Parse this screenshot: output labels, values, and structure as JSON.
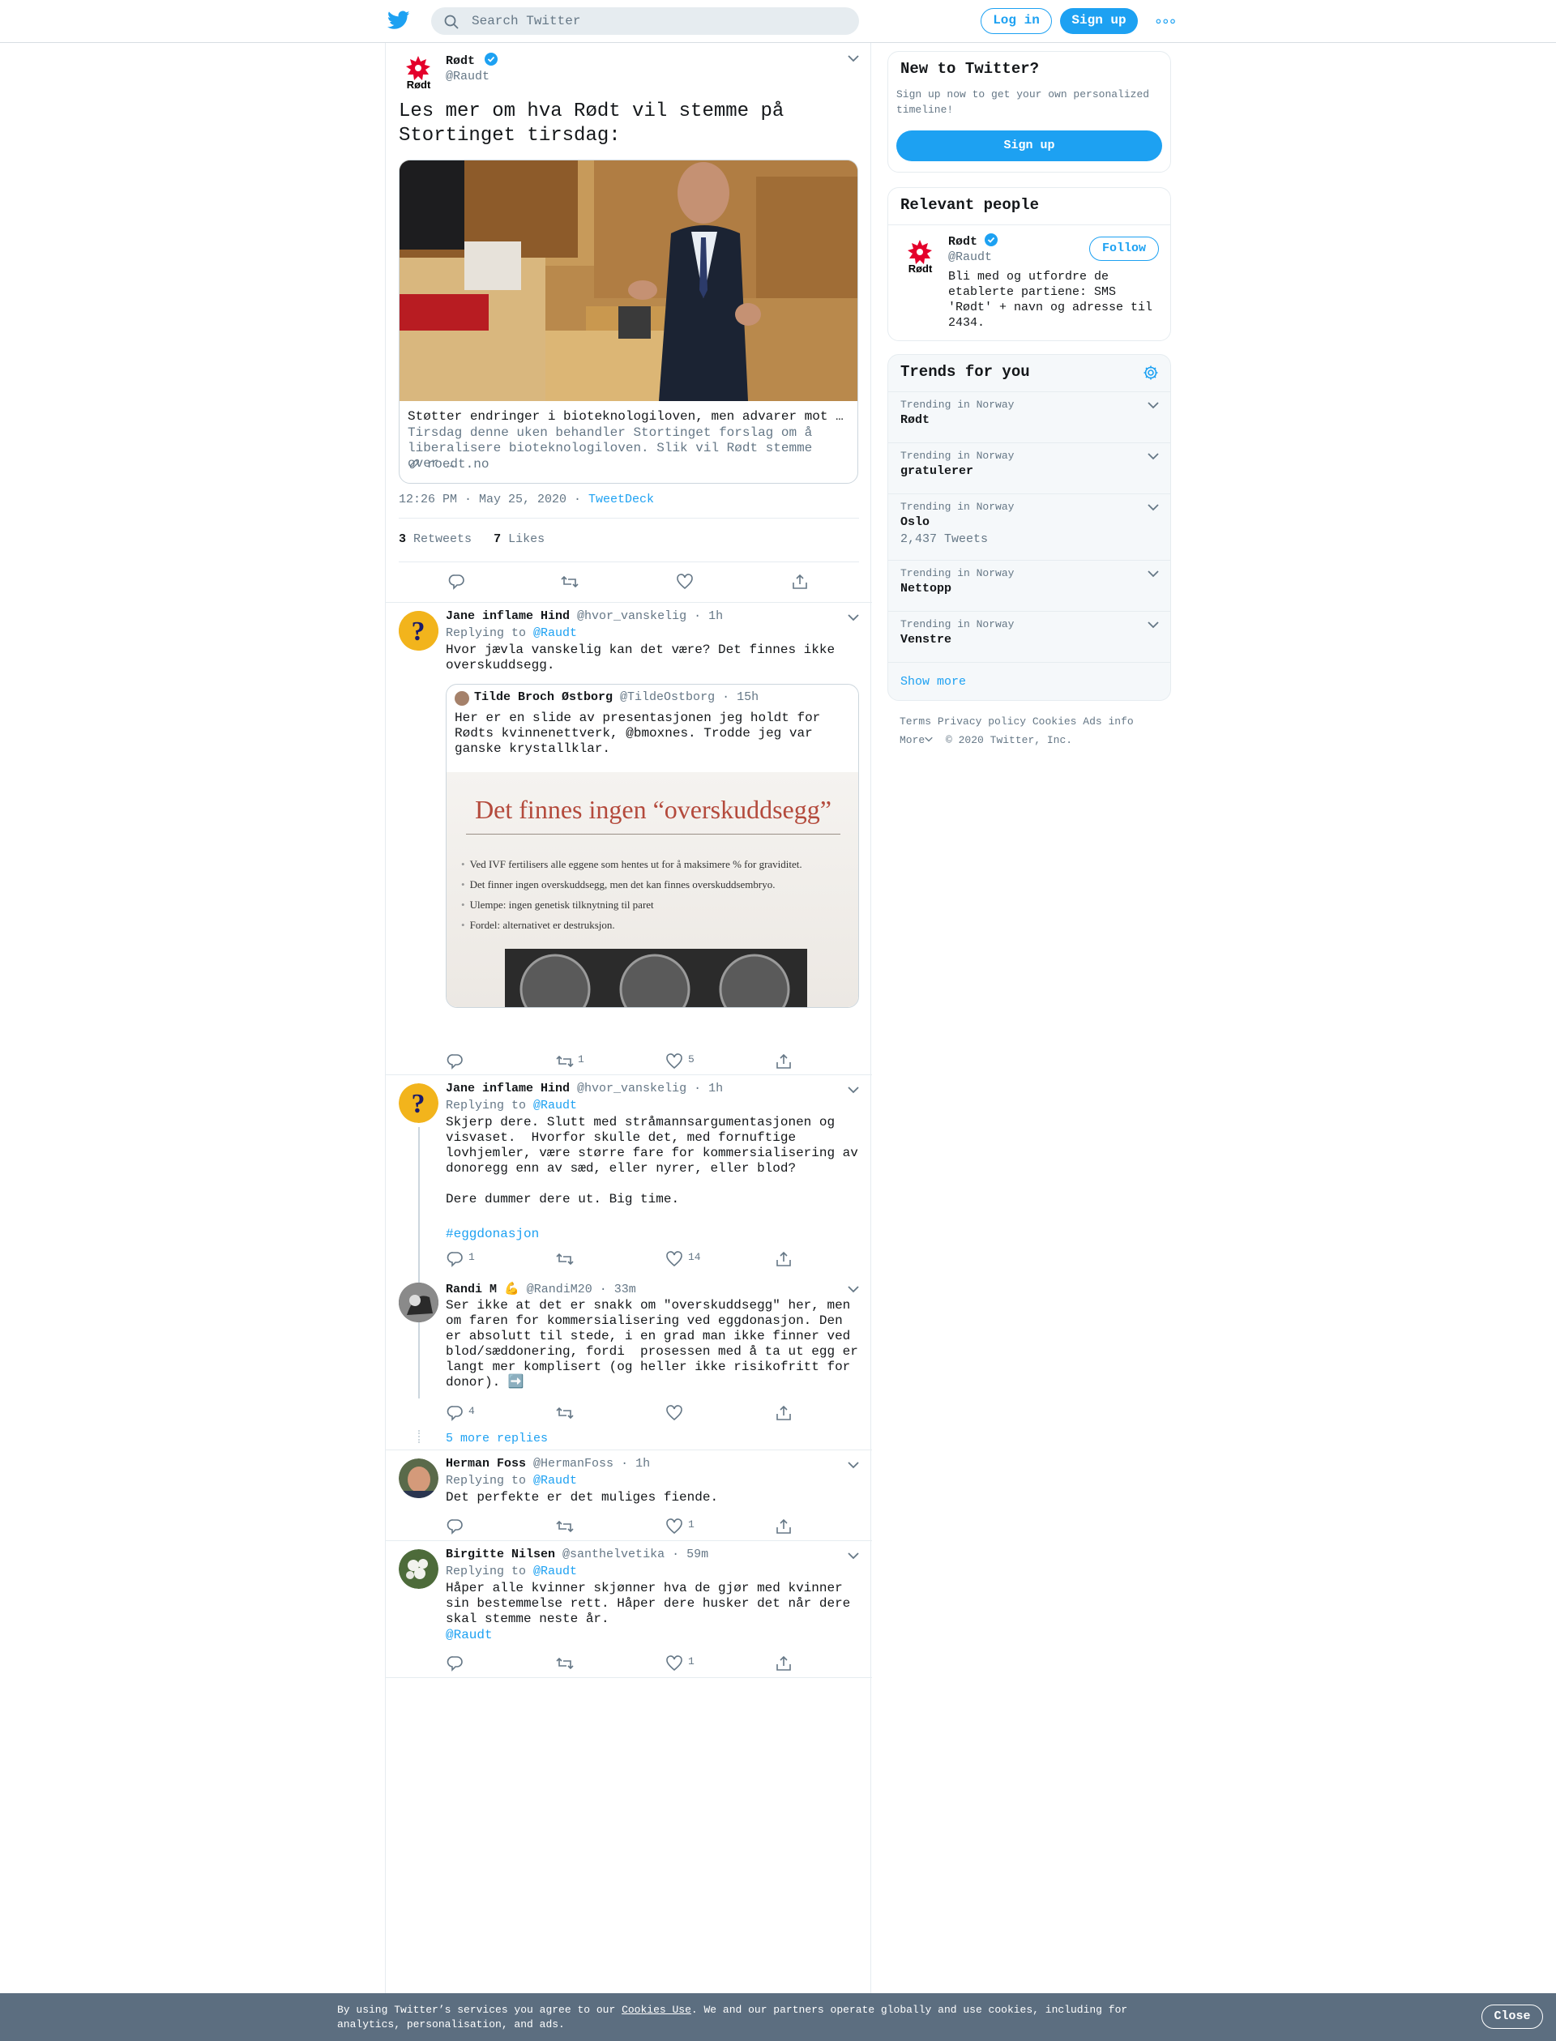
{
  "topbar": {
    "search_placeholder": "Search Twitter",
    "login_label": "Log in",
    "signup_label": "Sign up"
  },
  "focal": {
    "name": "Rødt",
    "handle": "@Raudt",
    "text": "Les mer om hva Rødt vil stemme på Stortinget tirsdag:",
    "card_title": "Støtter endringer i bioteknologiloven, men advarer mot kommersialisering",
    "card_desc": "Tirsdag denne uken behandler Stortinget forslag om å liberalisere bioteknologiloven. Slik vil Rødt stemme over …",
    "card_link": "roedt.no",
    "time": "12:26 PM · May 25, 2020 · ",
    "client": "TweetDeck",
    "retweets": "3",
    "retweets_label": "Retweets",
    "likes": "7",
    "likes_label": "Likes"
  },
  "replies": [
    {
      "name": "Jane inflame Hind",
      "handle": "@hvor_vanskelig",
      "time": "· 1h",
      "replying": "Replying to",
      "replying_to": "@Raudt",
      "text": "Hvor jævla vanskelig kan det være? Det finnes ikke overskuddsegg.",
      "quote": {
        "name": "Tilde Broch Østborg",
        "handle": "@TildeOstborg",
        "time": "· 15h",
        "text": "Her er en slide av presentasjonen jeg holdt for Rødts kvinnenettverk, @bmoxnes. Trodde jeg var ganske krystallklar.",
        "slide_title": "Det finnes ingen “overskuddsegg”",
        "bullets": [
          "Ved IVF fertilisers alle eggene som hentes ut for å maksimere % for graviditet.",
          "Det finner ingen overskuddsegg, men det kan finnes overskuddsembryo.",
          "Ulempe: ingen genetisk tilknytning til paret",
          "Fordel: alternativet er destruksjon."
        ]
      },
      "retweets": "1",
      "likes": "5"
    },
    {
      "name": "Jane inflame Hind",
      "handle": "@hvor_vanskelig",
      "time": "· 1h",
      "replying": "Replying to",
      "replying_to": "@Raudt",
      "text": "Skjerp dere. Slutt med stråmannsargumentasjonen og visvaset.  Hvorfor skulle det, med fornuftige lovhjemler, være større fare for kommersialisering av donoregg enn av sæd, eller nyrer, eller blod?\n\nDere dummer dere ut. Big time.",
      "hashtag": "#eggdonasjon",
      "comments": "1",
      "likes": "14"
    },
    {
      "name": "Randi M",
      "emoji": "💪",
      "handle": "@RandiM20",
      "time": "· 33m",
      "text": "Ser ikke at det er snakk om \"overskuddsegg\" her, men om faren for kommersialisering ved eggdonasjon. Den er absolutt til stede, i en grad man ikke finner ved blod/sæddonering, fordi  prosessen med å ta ut egg er langt mer komplisert (og heller ikke risikofritt for donor).",
      "arrow": "➡️",
      "comments": "4",
      "more_replies": "5 more replies"
    },
    {
      "name": "Herman Foss",
      "handle": "@HermanFoss",
      "time": "· 1h",
      "replying": "Replying to",
      "replying_to": "@Raudt",
      "text": "Det perfekte er det muliges fiende.",
      "likes": "1"
    },
    {
      "name": "Birgitte Nilsen",
      "handle": "@santhelvetika",
      "time": "· 59m",
      "replying": "Replying to",
      "replying_to": "@Raudt",
      "text": "Håper alle kvinner skjønner hva de gjør med kvinner sin bestemmelse rett. Håper dere husker det når dere skal stemme neste år.",
      "mention": "@Raudt",
      "likes": "1"
    }
  ],
  "sidebar": {
    "new_title": "New to Twitter?",
    "new_desc": "Sign up now to get your own personalized timeline!",
    "new_signup": "Sign up",
    "relevant_title": "Relevant people",
    "person_name": "Rødt",
    "person_handle": "@Raudt",
    "follow_label": "Follow",
    "person_bio": "Bli med og utfordre de etablerte partiene: SMS 'Rødt' + navn og adresse til 2434.",
    "trends_title": "Trends for you",
    "trends": [
      {
        "location": "Trending in Norway",
        "name": "Rødt",
        "sub": ""
      },
      {
        "location": "Trending in Norway",
        "name": "gratulerer",
        "sub": ""
      },
      {
        "location": "Trending in Norway",
        "name": "Oslo",
        "sub": "2,437 Tweets"
      },
      {
        "location": "Trending in Norway",
        "name": "Nettopp",
        "sub": ""
      },
      {
        "location": "Trending in Norway",
        "name": "Venstre",
        "sub": ""
      }
    ],
    "show_more": "Show more",
    "footer_links": [
      "Terms",
      "Privacy policy",
      "Cookies",
      "Ads info"
    ],
    "footer_more": "More",
    "copyright": "© 2020 Twitter, Inc."
  },
  "cookie": {
    "text_before": "By using Twitter’s services you agree to our ",
    "link": "Cookies Use",
    "text_after": ". We and our partners operate globally and use cookies, including for analytics, personalisation, and ads.",
    "close": "Close"
  },
  "colors": {
    "accent": "#1da1f2",
    "rodt_red": "#e4002b",
    "banner": "#5c6e80"
  }
}
